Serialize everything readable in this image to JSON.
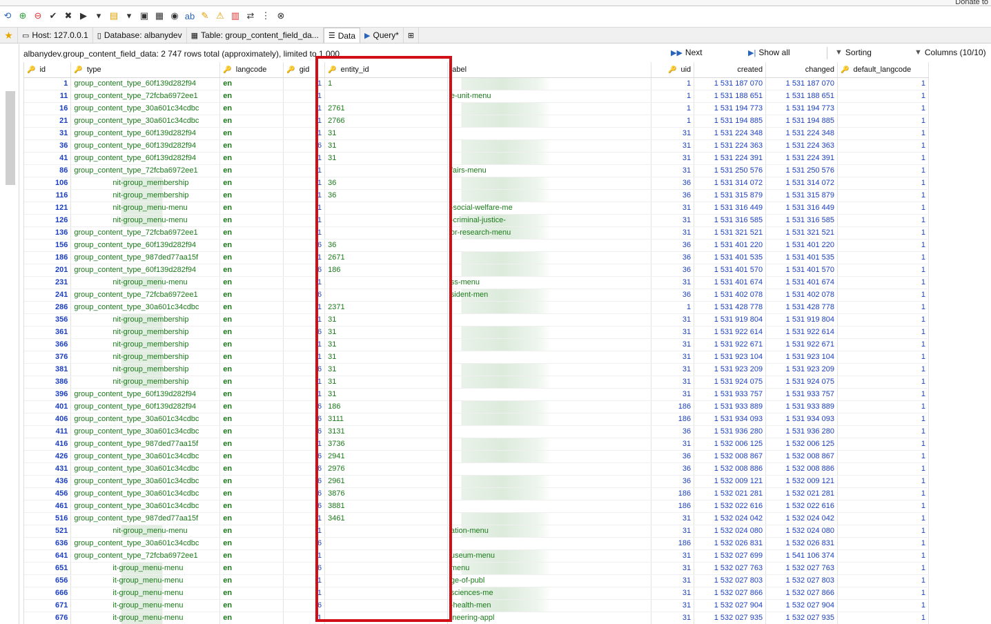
{
  "toolbar": {
    "donate_label": "Donate to",
    "icons": [
      "refresh-icon",
      "add-icon",
      "delete-icon",
      "check-icon",
      "cancel-icon",
      "run-icon",
      "dropdown-icon",
      "open-icon",
      "dropdown-icon",
      "save-icon",
      "save-as-icon",
      "binoculars-icon",
      "find-replace-icon",
      "edit-icon",
      "warning-icon",
      "format-icon",
      "export-icon",
      "more-icon",
      "stop-icon"
    ]
  },
  "tabs": {
    "host": "Host: 127.0.0.1",
    "database": "Database: albanydev",
    "table": "Table: group_content_field_da...",
    "data": "Data",
    "query": "Query*"
  },
  "info": {
    "summary": "albanydev.group_content_field_data: 2 747 rows total (approximately), limited to 1 000",
    "next": "Next",
    "show_all": "Show all",
    "sorting": "Sorting",
    "columns": "Columns (10/10)"
  },
  "columns": [
    "id",
    "type",
    "langcode",
    "gid",
    "entity_id",
    "label",
    "uid",
    "created",
    "changed",
    "default_langcode"
  ],
  "rows": [
    [
      "1",
      "group_content_type_60f139d282f94",
      "en",
      "1",
      "1",
      "",
      "1",
      "1 531 187 070",
      "1 531 187 070",
      "1"
    ],
    [
      "11",
      "group_content_type_72fcba6972ee1",
      "en",
      "1",
      "",
      "e-unit-menu",
      "1",
      "1 531 188 651",
      "1 531 188 651",
      "1"
    ],
    [
      "16",
      "group_content_type_30a601c34cdbc",
      "en",
      "1",
      "2761",
      "",
      "1",
      "1 531 194 773",
      "1 531 194 773",
      "1"
    ],
    [
      "21",
      "group_content_type_30a601c34cdbc",
      "en",
      "1",
      "2766",
      "",
      "1",
      "1 531 194 885",
      "1 531 194 885",
      "1"
    ],
    [
      "31",
      "group_content_type_60f139d282f94",
      "en",
      "1",
      "31",
      "",
      "31",
      "1 531 224 348",
      "1 531 224 348",
      "1"
    ],
    [
      "36",
      "group_content_type_60f139d282f94",
      "en",
      "6",
      "31",
      "",
      "31",
      "1 531 224 363",
      "1 531 224 363",
      "1"
    ],
    [
      "41",
      "group_content_type_60f139d282f94",
      "en",
      "1",
      "31",
      "",
      "31",
      "1 531 224 391",
      "1 531 224 391",
      "1"
    ],
    [
      "86",
      "group_content_type_72fcba6972ee1",
      "en",
      "1",
      "",
      "fairs-menu",
      "31",
      "1 531 250 576",
      "1 531 250 576",
      "1"
    ],
    [
      "106",
      "",
      "en",
      "1",
      "36",
      "",
      "36",
      "1 531 314 072",
      "1 531 314 072",
      "1"
    ],
    [
      "116",
      "",
      "en",
      "1",
      "36",
      "",
      "36",
      "1 531 315 879",
      "1 531 315 879",
      "1"
    ],
    [
      "121",
      "",
      "en",
      "1",
      "",
      "-social-welfare-me",
      "31",
      "1 531 316 449",
      "1 531 316 449",
      "1"
    ],
    [
      "126",
      "",
      "en",
      "1",
      "",
      "-criminal-justice-",
      "31",
      "1 531 316 585",
      "1 531 316 585",
      "1"
    ],
    [
      "136",
      "group_content_type_72fcba6972ee1",
      "en",
      "1",
      "",
      "or-research-menu",
      "31",
      "1 531 321 521",
      "1 531 321 521",
      "1"
    ],
    [
      "156",
      "group_content_type_60f139d282f94",
      "en",
      "6",
      "36",
      "",
      "36",
      "1 531 401 220",
      "1 531 401 220",
      "1"
    ],
    [
      "186",
      "group_content_type_987ded77aa15f",
      "en",
      "1",
      "2671",
      "",
      "36",
      "1 531 401 535",
      "1 531 401 535",
      "1"
    ],
    [
      "201",
      "group_content_type_60f139d282f94",
      "en",
      "6",
      "186",
      "",
      "36",
      "1 531 401 570",
      "1 531 401 570",
      "1"
    ],
    [
      "231",
      "",
      "en",
      "1",
      "",
      "ss-menu",
      "31",
      "1 531 401 674",
      "1 531 401 674",
      "1"
    ],
    [
      "241",
      "group_content_type_72fcba6972ee1",
      "en",
      "6",
      "",
      "sident-men",
      "36",
      "1 531 402 078",
      "1 531 402 078",
      "1"
    ],
    [
      "286",
      "group_content_type_30a601c34cdbc",
      "en",
      "1",
      "2371",
      "",
      "1",
      "1 531 428 778",
      "1 531 428 778",
      "1"
    ],
    [
      "356",
      "",
      "en",
      "1",
      "31",
      "",
      "31",
      "1 531 919 804",
      "1 531 919 804",
      "1"
    ],
    [
      "361",
      "",
      "en",
      "6",
      "31",
      "",
      "31",
      "1 531 922 614",
      "1 531 922 614",
      "1"
    ],
    [
      "366",
      "",
      "en",
      "1",
      "31",
      "",
      "31",
      "1 531 922 671",
      "1 531 922 671",
      "1"
    ],
    [
      "376",
      "",
      "en",
      "1",
      "31",
      "",
      "31",
      "1 531 923 104",
      "1 531 923 104",
      "1"
    ],
    [
      "381",
      "",
      "en",
      "6",
      "31",
      "",
      "31",
      "1 531 923 209",
      "1 531 923 209",
      "1"
    ],
    [
      "386",
      "",
      "en",
      "1",
      "31",
      "",
      "31",
      "1 531 924 075",
      "1 531 924 075",
      "1"
    ],
    [
      "396",
      "group_content_type_60f139d282f94",
      "en",
      "1",
      "31",
      "",
      "31",
      "1 531 933 757",
      "1 531 933 757",
      "1"
    ],
    [
      "401",
      "group_content_type_60f139d282f94",
      "en",
      "6",
      "186",
      "",
      "186",
      "1 531 933 889",
      "1 531 933 889",
      "1"
    ],
    [
      "406",
      "group_content_type_30a601c34cdbc",
      "en",
      "6",
      "3111",
      "",
      "186",
      "1 531 934 093",
      "1 531 934 093",
      "1"
    ],
    [
      "411",
      "group_content_type_30a601c34cdbc",
      "en",
      "6",
      "3131",
      "",
      "36",
      "1 531 936 280",
      "1 531 936 280",
      "1"
    ],
    [
      "416",
      "group_content_type_987ded77aa15f",
      "en",
      "1",
      "3736",
      "",
      "31",
      "1 532 006 125",
      "1 532 006 125",
      "1"
    ],
    [
      "426",
      "group_content_type_30a601c34cdbc",
      "en",
      "6",
      "2941",
      "",
      "36",
      "1 532 008 867",
      "1 532 008 867",
      "1"
    ],
    [
      "431",
      "group_content_type_30a601c34cdbc",
      "en",
      "6",
      "2976",
      "",
      "36",
      "1 532 008 886",
      "1 532 008 886",
      "1"
    ],
    [
      "436",
      "group_content_type_30a601c34cdbc",
      "en",
      "6",
      "2961",
      "",
      "36",
      "1 532 009 121",
      "1 532 009 121",
      "1"
    ],
    [
      "456",
      "group_content_type_30a601c34cdbc",
      "en",
      "6",
      "3876",
      "",
      "186",
      "1 532 021 281",
      "1 532 021 281",
      "1"
    ],
    [
      "461",
      "group_content_type_30a601c34cdbc",
      "en",
      "6",
      "3881",
      "",
      "186",
      "1 532 022 616",
      "1 532 022 616",
      "1"
    ],
    [
      "516",
      "group_content_type_987ded77aa15f",
      "en",
      "1",
      "3461",
      "",
      "31",
      "1 532 024 042",
      "1 532 024 042",
      "1"
    ],
    [
      "521",
      "",
      "en",
      "1",
      "",
      "ation-menu",
      "31",
      "1 532 024 080",
      "1 532 024 080",
      "1"
    ],
    [
      "636",
      "group_content_type_30a601c34cdbc",
      "en",
      "6",
      "",
      "",
      "186",
      "1 532 026 831",
      "1 532 026 831",
      "1"
    ],
    [
      "641",
      "group_content_type_72fcba6972ee1",
      "en",
      "1",
      "",
      "useum-menu",
      "31",
      "1 532 027 699",
      "1 541 106 374",
      "1"
    ],
    [
      "651",
      "",
      "en",
      "6",
      "",
      "menu",
      "31",
      "1 532 027 763",
      "1 532 027 763",
      "1"
    ],
    [
      "656",
      "",
      "en",
      "1",
      "",
      "ge-of-publ",
      "31",
      "1 532 027 803",
      "1 532 027 803",
      "1"
    ],
    [
      "666",
      "",
      "en",
      "1",
      "",
      "sciences-me",
      "31",
      "1 532 027 866",
      "1 532 027 866",
      "1"
    ],
    [
      "671",
      "",
      "en",
      "6",
      "",
      "-health-men",
      "31",
      "1 532 027 904",
      "1 532 027 904",
      "1"
    ],
    [
      "676",
      "",
      "en",
      "1",
      "",
      "ineering-appl",
      "31",
      "1 532 027 935",
      "1 532 027 935",
      "1"
    ]
  ],
  "type_suffixes": {
    "106": "nit-group_membership",
    "116": "nit-group_membership",
    "121": "nit-group_menu-menu",
    "126": "nit-group_menu-menu",
    "231": "nit-group_menu-menu",
    "356": "nit-group_membership",
    "361": "nit-group_membership",
    "366": "nit-group_membership",
    "376": "nit-group_membership",
    "381": "nit-group_membership",
    "386": "nit-group_membership",
    "521": "nit-group_menu-menu",
    "651": "it-group_menu-menu",
    "656": "it-group_menu-menu",
    "666": "it-group_menu-menu",
    "671": "it-group_menu-menu",
    "676": "it-group_menu-menu"
  },
  "colors": {
    "highlight": "#d10f16",
    "number": "#1a3ec0",
    "text": "#1a7a1a"
  }
}
